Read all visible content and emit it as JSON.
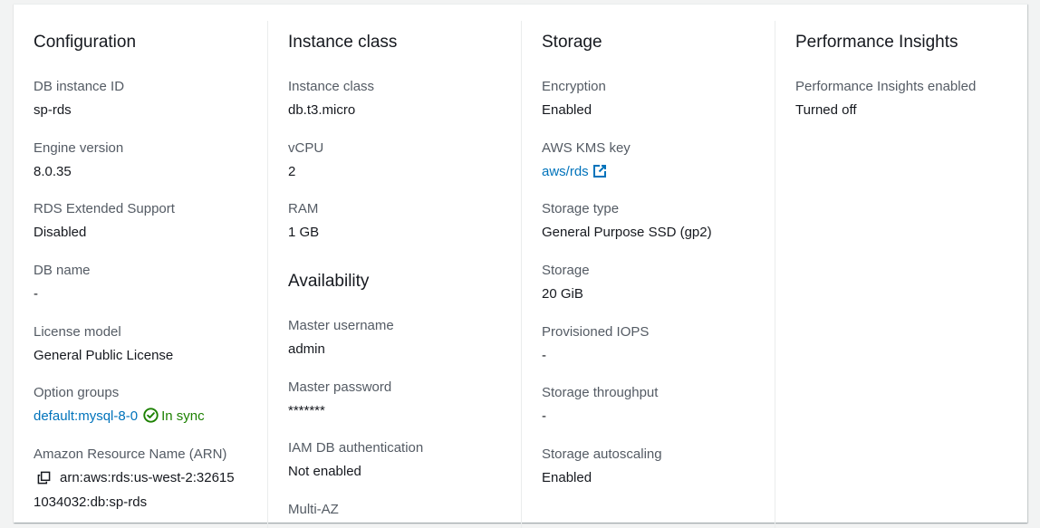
{
  "configuration": {
    "heading": "Configuration",
    "fields": [
      {
        "label": "DB instance ID",
        "value": "sp-rds"
      },
      {
        "label": "Engine version",
        "value": "8.0.35"
      },
      {
        "label": "RDS Extended Support",
        "value": "Disabled"
      },
      {
        "label": "DB name",
        "value": "-"
      },
      {
        "label": "License model",
        "value": "General Public License"
      },
      {
        "label": "Option groups",
        "value": "default:mysql-8-0",
        "status": "In sync"
      },
      {
        "label": "Amazon Resource Name (ARN)",
        "value_line1": "arn:aws:rds:us-west-2:32615",
        "value_line2": "1034032:db:sp-rds"
      }
    ]
  },
  "instance_class": {
    "heading": "Instance class",
    "fields": [
      {
        "label": "Instance class",
        "value": "db.t3.micro"
      },
      {
        "label": "vCPU",
        "value": "2"
      },
      {
        "label": "RAM",
        "value": "1 GB"
      }
    ]
  },
  "availability": {
    "heading": "Availability",
    "fields": [
      {
        "label": "Master username",
        "value": "admin"
      },
      {
        "label": "Master password",
        "value": "*******"
      },
      {
        "label": "IAM DB authentication",
        "value": "Not enabled"
      },
      {
        "label": "Multi-AZ"
      }
    ]
  },
  "storage": {
    "heading": "Storage",
    "fields": [
      {
        "label": "Encryption",
        "value": "Enabled"
      },
      {
        "label": "AWS KMS key",
        "value": "aws/rds"
      },
      {
        "label": "Storage type",
        "value": "General Purpose SSD (gp2)"
      },
      {
        "label": "Storage",
        "value": "20 GiB"
      },
      {
        "label": "Provisioned IOPS",
        "value": "-"
      },
      {
        "label": "Storage throughput",
        "value": "-"
      },
      {
        "label": "Storage autoscaling",
        "value": "Enabled"
      }
    ]
  },
  "performance_insights": {
    "heading": "Performance Insights",
    "fields": [
      {
        "label": "Performance Insights enabled",
        "value": "Turned off"
      }
    ]
  },
  "icons": {
    "external_link": "external-link-icon",
    "status_ok": "check-circle-icon",
    "copy": "copy-icon"
  },
  "colors": {
    "link": "#0073bb",
    "success": "#1d8102",
    "label": "#545b64",
    "text": "#16191f"
  }
}
